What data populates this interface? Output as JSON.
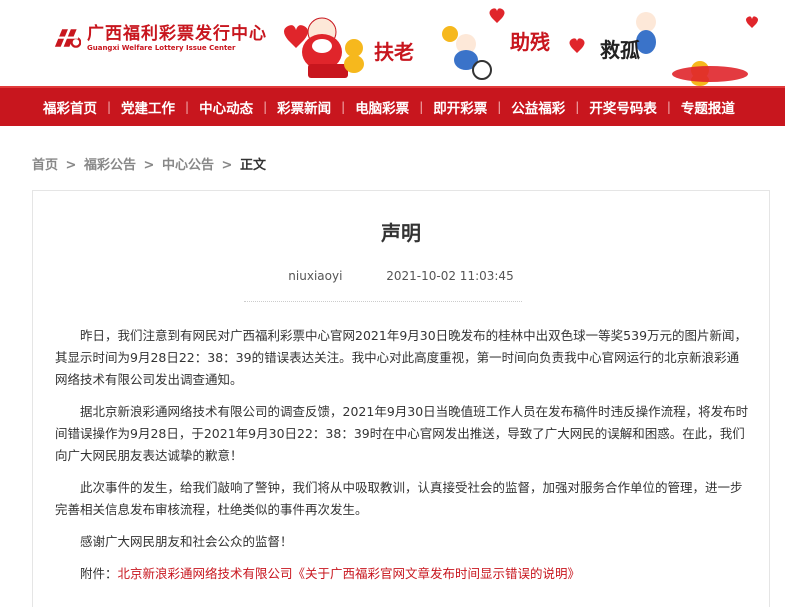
{
  "header": {
    "logo_cn": "广西福利彩票发行中心",
    "logo_en": "Guangxi Welfare Lottery Issue Center",
    "slogans": [
      "扶老",
      "助残",
      "救孤"
    ],
    "brand_color": "#c8161e"
  },
  "nav": {
    "items": [
      "福彩首页",
      "党建工作",
      "中心动态",
      "彩票新闻",
      "电脑彩票",
      "即开彩票",
      "公益福彩",
      "开奖号码表",
      "专题报道"
    ],
    "separator": "|"
  },
  "breadcrumb": {
    "items": [
      "首页",
      "福彩公告",
      "中心公告",
      "正文"
    ],
    "separator": ">"
  },
  "article": {
    "title": "声明",
    "author": "niuxiaoyi",
    "datetime": "2021-10-02 11:03:45",
    "paragraphs": [
      "昨日，我们注意到有网民对广西福利彩票中心官网2021年9月30日晚发布的桂林中出双色球一等奖539万元的图片新闻，其显示时间为9月28日22：38：39的错误表达关注。我中心对此高度重视，第一时间向负责我中心官网运行的北京新浪彩通网络技术有限公司发出调查通知。",
      "据北京新浪彩通网络技术有限公司的调查反馈，2021年9月30日当晚值班工作人员在发布稿件时违反操作流程，将发布时间错误操作为9月28日，于2021年9月30日22：38：39时在中心官网发出推送，导致了广大网民的误解和困惑。在此，我们向广大网民朋友表达诚挚的歉意！",
      "此次事件的发生，给我们敲响了警钟，我们将从中吸取教训，认真接受社会的监督，加强对服务合作单位的管理，进一步完善相关信息发布审核流程，杜绝类似的事件再次发生。",
      "感谢广大网民朋友和社会公众的监督！"
    ],
    "attachment_label": "附件：",
    "attachment_link": "北京新浪彩通网络技术有限公司《关于广西福彩官网文章发布时间显示错误的说明》"
  }
}
